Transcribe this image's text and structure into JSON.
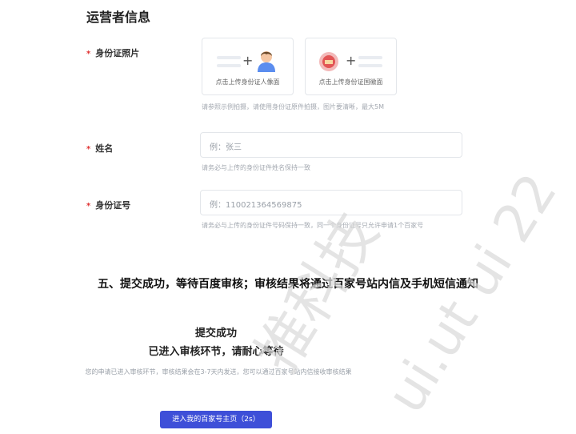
{
  "operator": {
    "section_title": "运营者信息",
    "required_mark": "*",
    "id_photo": {
      "label": "身份证照片",
      "portrait_caption": "点击上传身份证人像面",
      "emblem_caption": "点击上传身份证国徽面",
      "hint": "请参照示例拍摄，请使用身份证原件拍摄，图片要清晰，最大5M"
    },
    "name": {
      "label": "姓名",
      "placeholder": "例：张三",
      "hint": "请务必与上传的身份证件姓名保持一致"
    },
    "id_number": {
      "label": "身份证号",
      "placeholder": "例：110021364569875",
      "hint": "请务必与上传的身份证件号码保持一致，同一个身份证号只允许申请1个百家号"
    }
  },
  "step_heading": "五、提交成功，等待百度审核；审核结果将通过百家号站内信及手机短信通知",
  "result": {
    "title": "提交成功",
    "subtitle": "已进入审核环节，请耐心等待",
    "description": "您的申请已进入审核环节，审核结果会在3-7天内发送，您可以通过百家号站内信接收审核结果",
    "button_label": "进入我的百家号主页（2s）"
  },
  "watermark": {
    "text_a": "推科技",
    "text_b": "ui.ut ui 22"
  },
  "colors": {
    "primary_button": "#3e4fd8",
    "required": "#e03131",
    "hint": "#a3a8b0"
  }
}
